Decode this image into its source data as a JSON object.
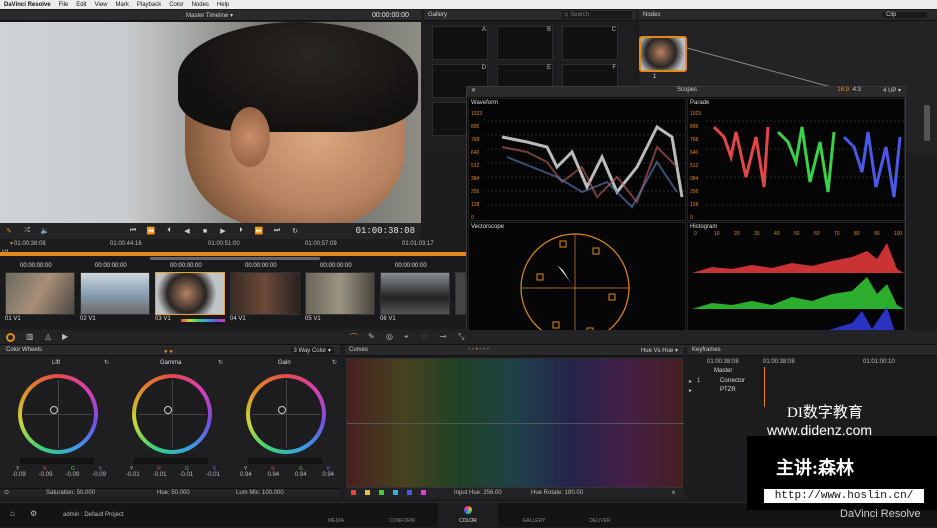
{
  "menubar": {
    "app": "DaVinci Resolve",
    "items": [
      "File",
      "Edit",
      "View",
      "Mark",
      "Playback",
      "Color",
      "Nodes",
      "Help"
    ]
  },
  "viewer": {
    "title": "Master Timeline",
    "timecode_top": "00:00:00:00",
    "timecode": "01:00:38:08"
  },
  "timeline": {
    "ticks": [
      "01:00:38:08",
      "01:00:44:16",
      "01:00:51:00",
      "01:00:57:09",
      "01:01:03:17"
    ],
    "track": "V1"
  },
  "clips": [
    {
      "tc": "00:00:00:00",
      "label": "01 V1"
    },
    {
      "tc": "00:00:00:00",
      "label": "02 V1"
    },
    {
      "tc": "00:00:00:00",
      "label": "03 V1"
    },
    {
      "tc": "00:00:00:00",
      "label": "04 V1"
    },
    {
      "tc": "00:00:00:00",
      "label": "05 V1"
    },
    {
      "tc": "00:00:00:00",
      "label": "06 V1"
    }
  ],
  "gallery": {
    "title": "Gallery",
    "search_placeholder": "Search",
    "cells": [
      "A",
      "B",
      "C",
      "D",
      "E",
      "F"
    ]
  },
  "nodes": {
    "title": "Nodes",
    "mode": "Clip",
    "node_label": "1"
  },
  "scopes": {
    "title": "Scopes",
    "ratios": [
      "16:9",
      "4:3"
    ],
    "layout": "4 UP",
    "waveform": "Waveform",
    "parade": "Parade",
    "vectorscope": "Vectorscope",
    "histogram": "Histogram",
    "y_labels": [
      "1023",
      "896",
      "768",
      "640",
      "512",
      "384",
      "256",
      "128",
      "0"
    ],
    "hist_x_labels": [
      "0",
      "10",
      "20",
      "30",
      "40",
      "50",
      "60",
      "70",
      "80",
      "90",
      "100"
    ]
  },
  "color_wheels": {
    "title": "Color Wheels",
    "mode": "3 Way Color",
    "wheels": [
      {
        "name": "Lift",
        "y": "-0.09",
        "r": "-0.09",
        "g": "-0.09",
        "b": "-0.09"
      },
      {
        "name": "Gamma",
        "y": "-0.01",
        "r": "-0.01",
        "g": "-0.01",
        "b": "-0.01"
      },
      {
        "name": "Gain",
        "y": "0.94",
        "r": "0.94",
        "g": "0.94",
        "b": "0.94"
      }
    ],
    "channel_labels": [
      "Y",
      "R",
      "G",
      "B"
    ],
    "saturation": "Saturation: 50.000",
    "hue": "Hue: 50.000",
    "lum_mix": "Lum Mix: 100.000"
  },
  "curves": {
    "title": "Curves",
    "mode": "Hue Vs Hue",
    "input_hue": "Input Hue: 256.00",
    "hue_rotate": "Hue Rotate: 180.00"
  },
  "keyframes": {
    "title": "Keyframes",
    "tc_left": "01:00:38:08",
    "tc_mid": "01:00:38:08",
    "tc_right": "01:01:00:10",
    "rows": [
      "Master",
      "Corrector",
      "PTZR"
    ],
    "row_num": "1"
  },
  "status": {
    "project": "admin : Default Project",
    "tabs": [
      "MEDIA",
      "CONFORM",
      "COLOR",
      "GALLERY",
      "DELIVER"
    ],
    "active": "COLOR",
    "brand": "DaVinci Resolve"
  },
  "watermark": {
    "line1": "DI数字教育",
    "line2": "www.didenz.com",
    "line3": "主讲:森林",
    "url": "http://www.hoslin.cn/"
  },
  "colors": {
    "accent": "#e08a1a",
    "selected_border": "#e8a030"
  }
}
